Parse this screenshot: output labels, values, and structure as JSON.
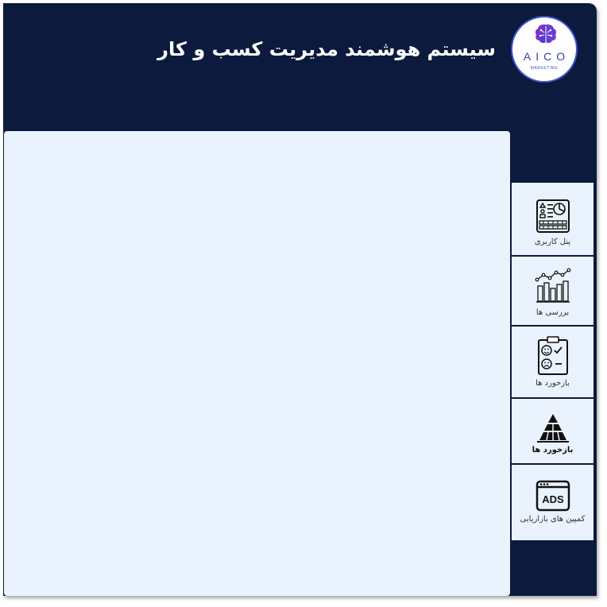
{
  "header": {
    "title": "سیستم هوشمند مدیریت کسب و کار",
    "logo_text": "AICO",
    "logo_subtext": "MARKETING"
  },
  "sidebar": {
    "items": [
      {
        "label": "پنل کاربری",
        "icon": "dashboard-icon"
      },
      {
        "label": "بررسی ها",
        "icon": "bar-chart-icon"
      },
      {
        "label": "بازخورد ها",
        "icon": "feedback-clipboard-icon"
      },
      {
        "label": "بازخورد ها",
        "icon": "pyramid-icon"
      },
      {
        "label": "کمپین های بازاریابی",
        "icon": "ads-icon"
      }
    ]
  },
  "colors": {
    "header_bg": "#0b1a3d",
    "content_bg": "#eaf2fd",
    "logo_accent": "#3b3fa8"
  }
}
